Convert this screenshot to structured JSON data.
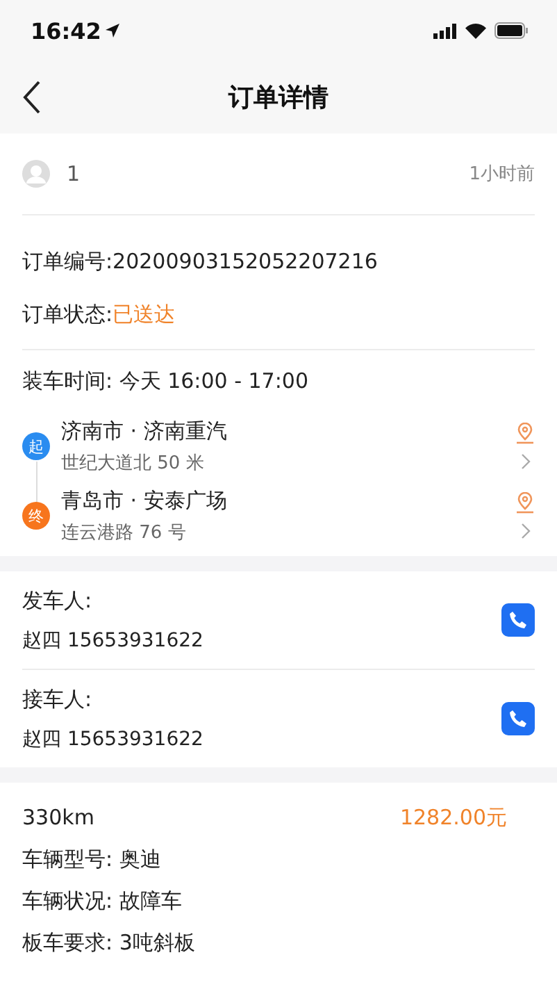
{
  "status_bar": {
    "time": "16:42"
  },
  "nav": {
    "title": "订单详情"
  },
  "poster": {
    "name": "1",
    "time": "1小时前"
  },
  "order": {
    "number": "订单编号:20200903152052207216",
    "status_label": "订单状态:",
    "status_value": "已送达"
  },
  "load_time": "装车时间: 今天 16:00 - 17:00",
  "route": [
    {
      "kind": "start",
      "badge": "起",
      "city": "济南市 · 济南重汽",
      "address": "世纪大道北 50 米"
    },
    {
      "kind": "end",
      "badge": "终",
      "city": "青岛市 · 安泰广场",
      "address": "连云港路 76 号"
    }
  ],
  "contacts": [
    {
      "role": "发车人:",
      "person": "赵四 15653931622"
    },
    {
      "role": "接车人:",
      "person": "赵四 15653931622"
    }
  ],
  "trip": {
    "distance": "330km",
    "price": "1282.00元",
    "details": [
      "车辆型号: 奥迪",
      "车辆状况: 故障车",
      "板车要求: 3吨斜板"
    ]
  }
}
